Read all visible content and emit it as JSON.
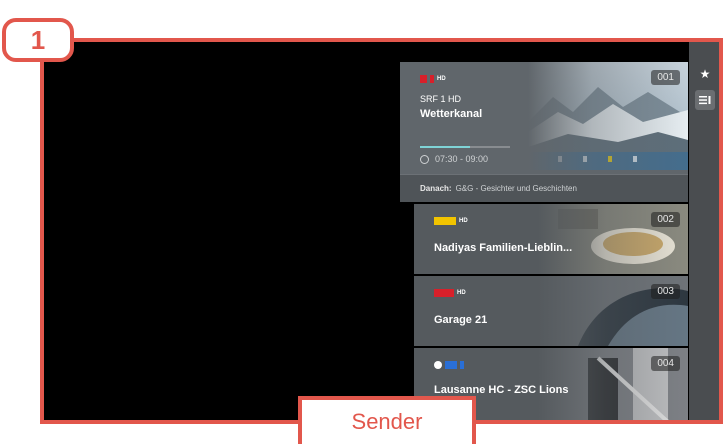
{
  "annotation": {
    "step": "1",
    "caption": "Sender"
  },
  "rail": {
    "items": [
      {
        "icon": "star-icon",
        "active": false
      },
      {
        "icon": "channel-list-icon",
        "active": true
      }
    ]
  },
  "featured": {
    "channel_logo": "SRF 1 HD",
    "number": "001",
    "channel_name": "SRF 1 HD",
    "program": "Wetterkanal",
    "progress": 0.55,
    "time": "07:30 - 09:00",
    "next_label": "Danach:",
    "next_program": "G&G - Gesichter und Geschichten"
  },
  "channels": [
    {
      "number": "002",
      "title": "Nadiyas Familien-Lieblin...",
      "logo_color": "#f2c400"
    },
    {
      "number": "003",
      "title": "Garage 21",
      "logo_color": "#d8202a"
    },
    {
      "number": "004",
      "title": "Lausanne HC - ZSC Lions",
      "logo_color": "#2a6fd6"
    }
  ],
  "colors": {
    "annotation": "#e2574c",
    "progress": "#7fd3d6"
  }
}
